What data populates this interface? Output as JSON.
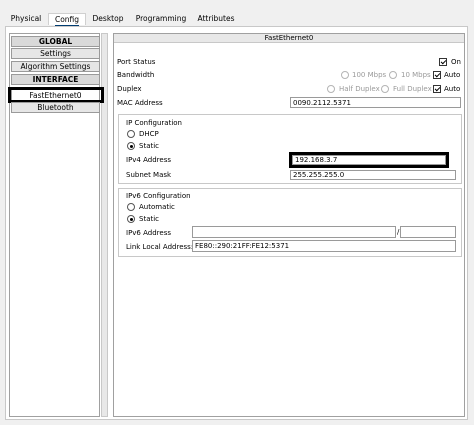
{
  "tabs": [
    "Physical",
    "Config",
    "Desktop",
    "Programming",
    "Attributes"
  ],
  "sidebar": {
    "global_heading": "GLOBAL",
    "settings": "Settings",
    "algorithm_settings": "Algorithm Settings",
    "interface_heading": "INTERFACE",
    "fastethernet": "FastEthernet0",
    "bluetooth": "Bluetooth"
  },
  "panel": {
    "title": "FastEthernet0",
    "port_status_label": "Port Status",
    "port_on_label": "On",
    "bandwidth_label": "Bandwidth",
    "bw_100": "100 Mbps",
    "bw_10": "10 Mbps",
    "bw_auto": "Auto",
    "duplex_label": "Duplex",
    "half_duplex": "Half Duplex",
    "full_duplex": "Full Duplex",
    "duplex_auto": "Auto",
    "mac_label": "MAC Address",
    "mac_value": "0090.2112.5371"
  },
  "ipv4": {
    "title": "IP Configuration",
    "dhcp": "DHCP",
    "static": "Static",
    "address_label": "IPv4 Address",
    "address_value": "192.168.3.7",
    "mask_label": "Subnet Mask",
    "mask_value": "255.255.255.0"
  },
  "ipv6": {
    "title": "IPv6 Configuration",
    "automatic": "Automatic",
    "static": "Static",
    "address_label": "IPv6 Address",
    "address_value": "",
    "prefix_separator": "/",
    "prefix_value": "",
    "link_local_label": "Link Local Address:",
    "link_local_value": "FE80::290:21FF:FE12:5371"
  },
  "colors": {
    "highlight_border": "#000000",
    "tab_underline": "#003c71"
  }
}
